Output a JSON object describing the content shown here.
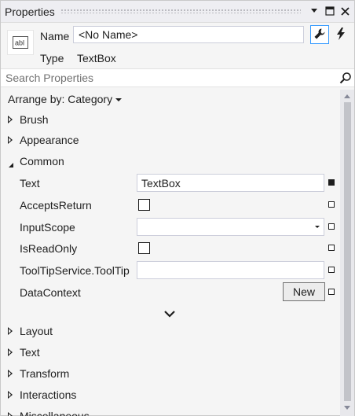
{
  "window": {
    "title": "Properties"
  },
  "header": {
    "name_label": "Name",
    "name_value": "<No Name>",
    "type_label": "Type",
    "type_value": "TextBox",
    "type_icon": "textbox-icon",
    "icon_text": "abl"
  },
  "search": {
    "placeholder": "Search Properties"
  },
  "arrange": {
    "label": "Arrange by: Category"
  },
  "categories_top": [
    {
      "label": "Brush",
      "expanded": false
    },
    {
      "label": "Appearance",
      "expanded": false
    },
    {
      "label": "Common",
      "expanded": true
    }
  ],
  "common_props": {
    "text": {
      "label": "Text",
      "value": "TextBox"
    },
    "accepts_return": {
      "label": "AcceptsReturn",
      "checked": false
    },
    "input_scope": {
      "label": "InputScope",
      "value": ""
    },
    "is_read_only": {
      "label": "IsReadOnly",
      "checked": false
    },
    "tooltip": {
      "label": "ToolTipService.ToolTip",
      "value": ""
    },
    "data_context": {
      "label": "DataContext",
      "button": "New"
    }
  },
  "categories_bottom": [
    {
      "label": "Layout"
    },
    {
      "label": "Text"
    },
    {
      "label": "Transform"
    },
    {
      "label": "Interactions"
    },
    {
      "label": "Miscellaneous"
    }
  ],
  "colors": {
    "accent": "#3399ff",
    "panel_bg": "#f5f5f5"
  }
}
